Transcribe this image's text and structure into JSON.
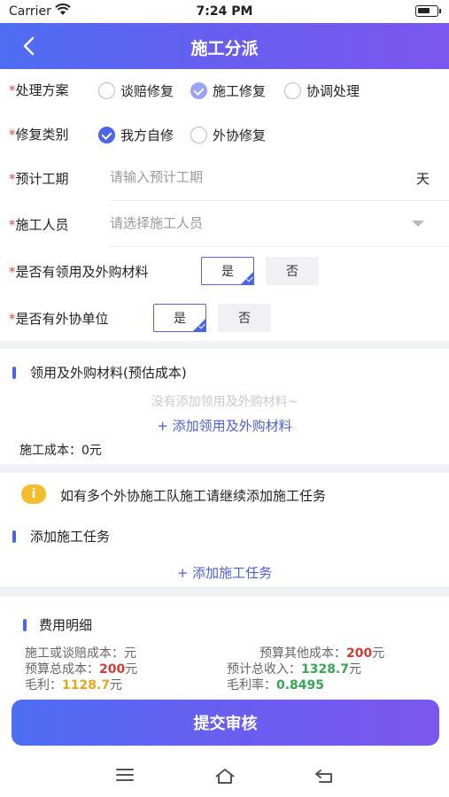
{
  "status_bar": {
    "carrier": "Carrier",
    "time": "7:24 PM"
  },
  "nav": {
    "title": "施工分派"
  },
  "form": {
    "plan": {
      "label": "处理方案",
      "options": [
        "谈赔修复",
        "施工修复",
        "协调处理"
      ],
      "selected": "施工修复"
    },
    "repair_type": {
      "label": "修复类别",
      "options": [
        "我方自修",
        "外协修复"
      ],
      "selected": "我方自修"
    },
    "duration": {
      "label": "预计工期",
      "placeholder": "请输入预计工期",
      "unit": "天"
    },
    "staff": {
      "label": "施工人员",
      "placeholder": "请选择施工人员"
    },
    "materials": {
      "label": "是否有领用及外购材料",
      "yes": "是",
      "no": "否",
      "selected": "是"
    },
    "outsource": {
      "label": "是否有外协单位",
      "yes": "是",
      "no": "否",
      "selected": "是"
    }
  },
  "materials_section": {
    "title": "领用及外购材料(预估成本)",
    "empty": "没有添加领用及外购材料~",
    "add": "+ 添加领用及外购材料",
    "cost": "施工成本：0元"
  },
  "notice": {
    "icon": "info-icon",
    "text": "如有多个外协施工队施工请继续添加施工任务"
  },
  "task_section": {
    "title": "添加施工任务",
    "add": "+ 添加施工任务"
  },
  "fee": {
    "title": "费用明细",
    "construction_cost_label": "施工或谈赔成本：",
    "construction_cost_unit": "元",
    "other_cost_label": "预算其他成本：",
    "other_cost_value": "200",
    "other_cost_unit": "元",
    "total_cost_label": "预算总成本：",
    "total_cost_value": "200",
    "total_cost_unit": "元",
    "income_label": "预计总收入：",
    "income_value": "1328.7",
    "income_unit": "元",
    "profit_label": "毛利：",
    "profit_value": "1128.7",
    "profit_unit": "元",
    "margin_label": "毛利率：",
    "margin_value": "0.8495"
  },
  "submit": {
    "label": "提交审核"
  },
  "colors": {
    "accent": "#4c64ea",
    "required": "#e8463c",
    "red": "#d63a33",
    "green": "#37a655",
    "gold": "#e3a81d"
  }
}
